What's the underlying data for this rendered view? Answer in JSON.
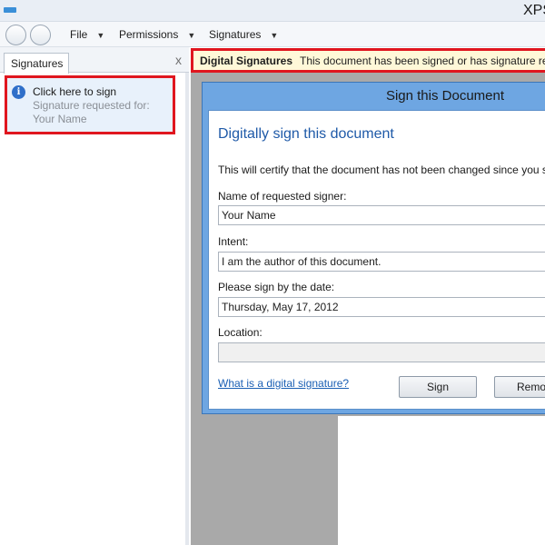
{
  "window": {
    "title": "XPS"
  },
  "menu": {
    "items": [
      {
        "label": "File"
      },
      {
        "label": "Permissions"
      },
      {
        "label": "Signatures"
      }
    ],
    "caret": "▼"
  },
  "left_pane": {
    "tab_label": "Signatures",
    "close_glyph": "x",
    "entry": {
      "title": "Click here to sign",
      "subtitle": "Signature requested for:",
      "name": "Your Name",
      "icon_glyph": "i"
    }
  },
  "infobar": {
    "title": "Digital Signatures",
    "message": "This document has been signed or has signature re"
  },
  "dialog": {
    "title": "Sign this Document",
    "heading": "Digitally sign this document",
    "description": "This will certify that the document has not been changed since you s",
    "signer_label": "Name of requested signer:",
    "signer_value": "Your Name",
    "intent_label": "Intent:",
    "intent_value": "I am the author of this document.",
    "date_label": "Please sign by the date:",
    "date_value": "Thursday, May 17, 2012",
    "location_label": "Location:",
    "location_value": "",
    "help_link": "What is a digital signature?",
    "sign_button": "Sign",
    "remove_button": "Remo"
  },
  "colors": {
    "highlight_border": "#e0161f",
    "dialog_frame": "#6ea6e2",
    "heading_blue": "#1f5aa8",
    "infobar_bg": "#fff8d8"
  }
}
